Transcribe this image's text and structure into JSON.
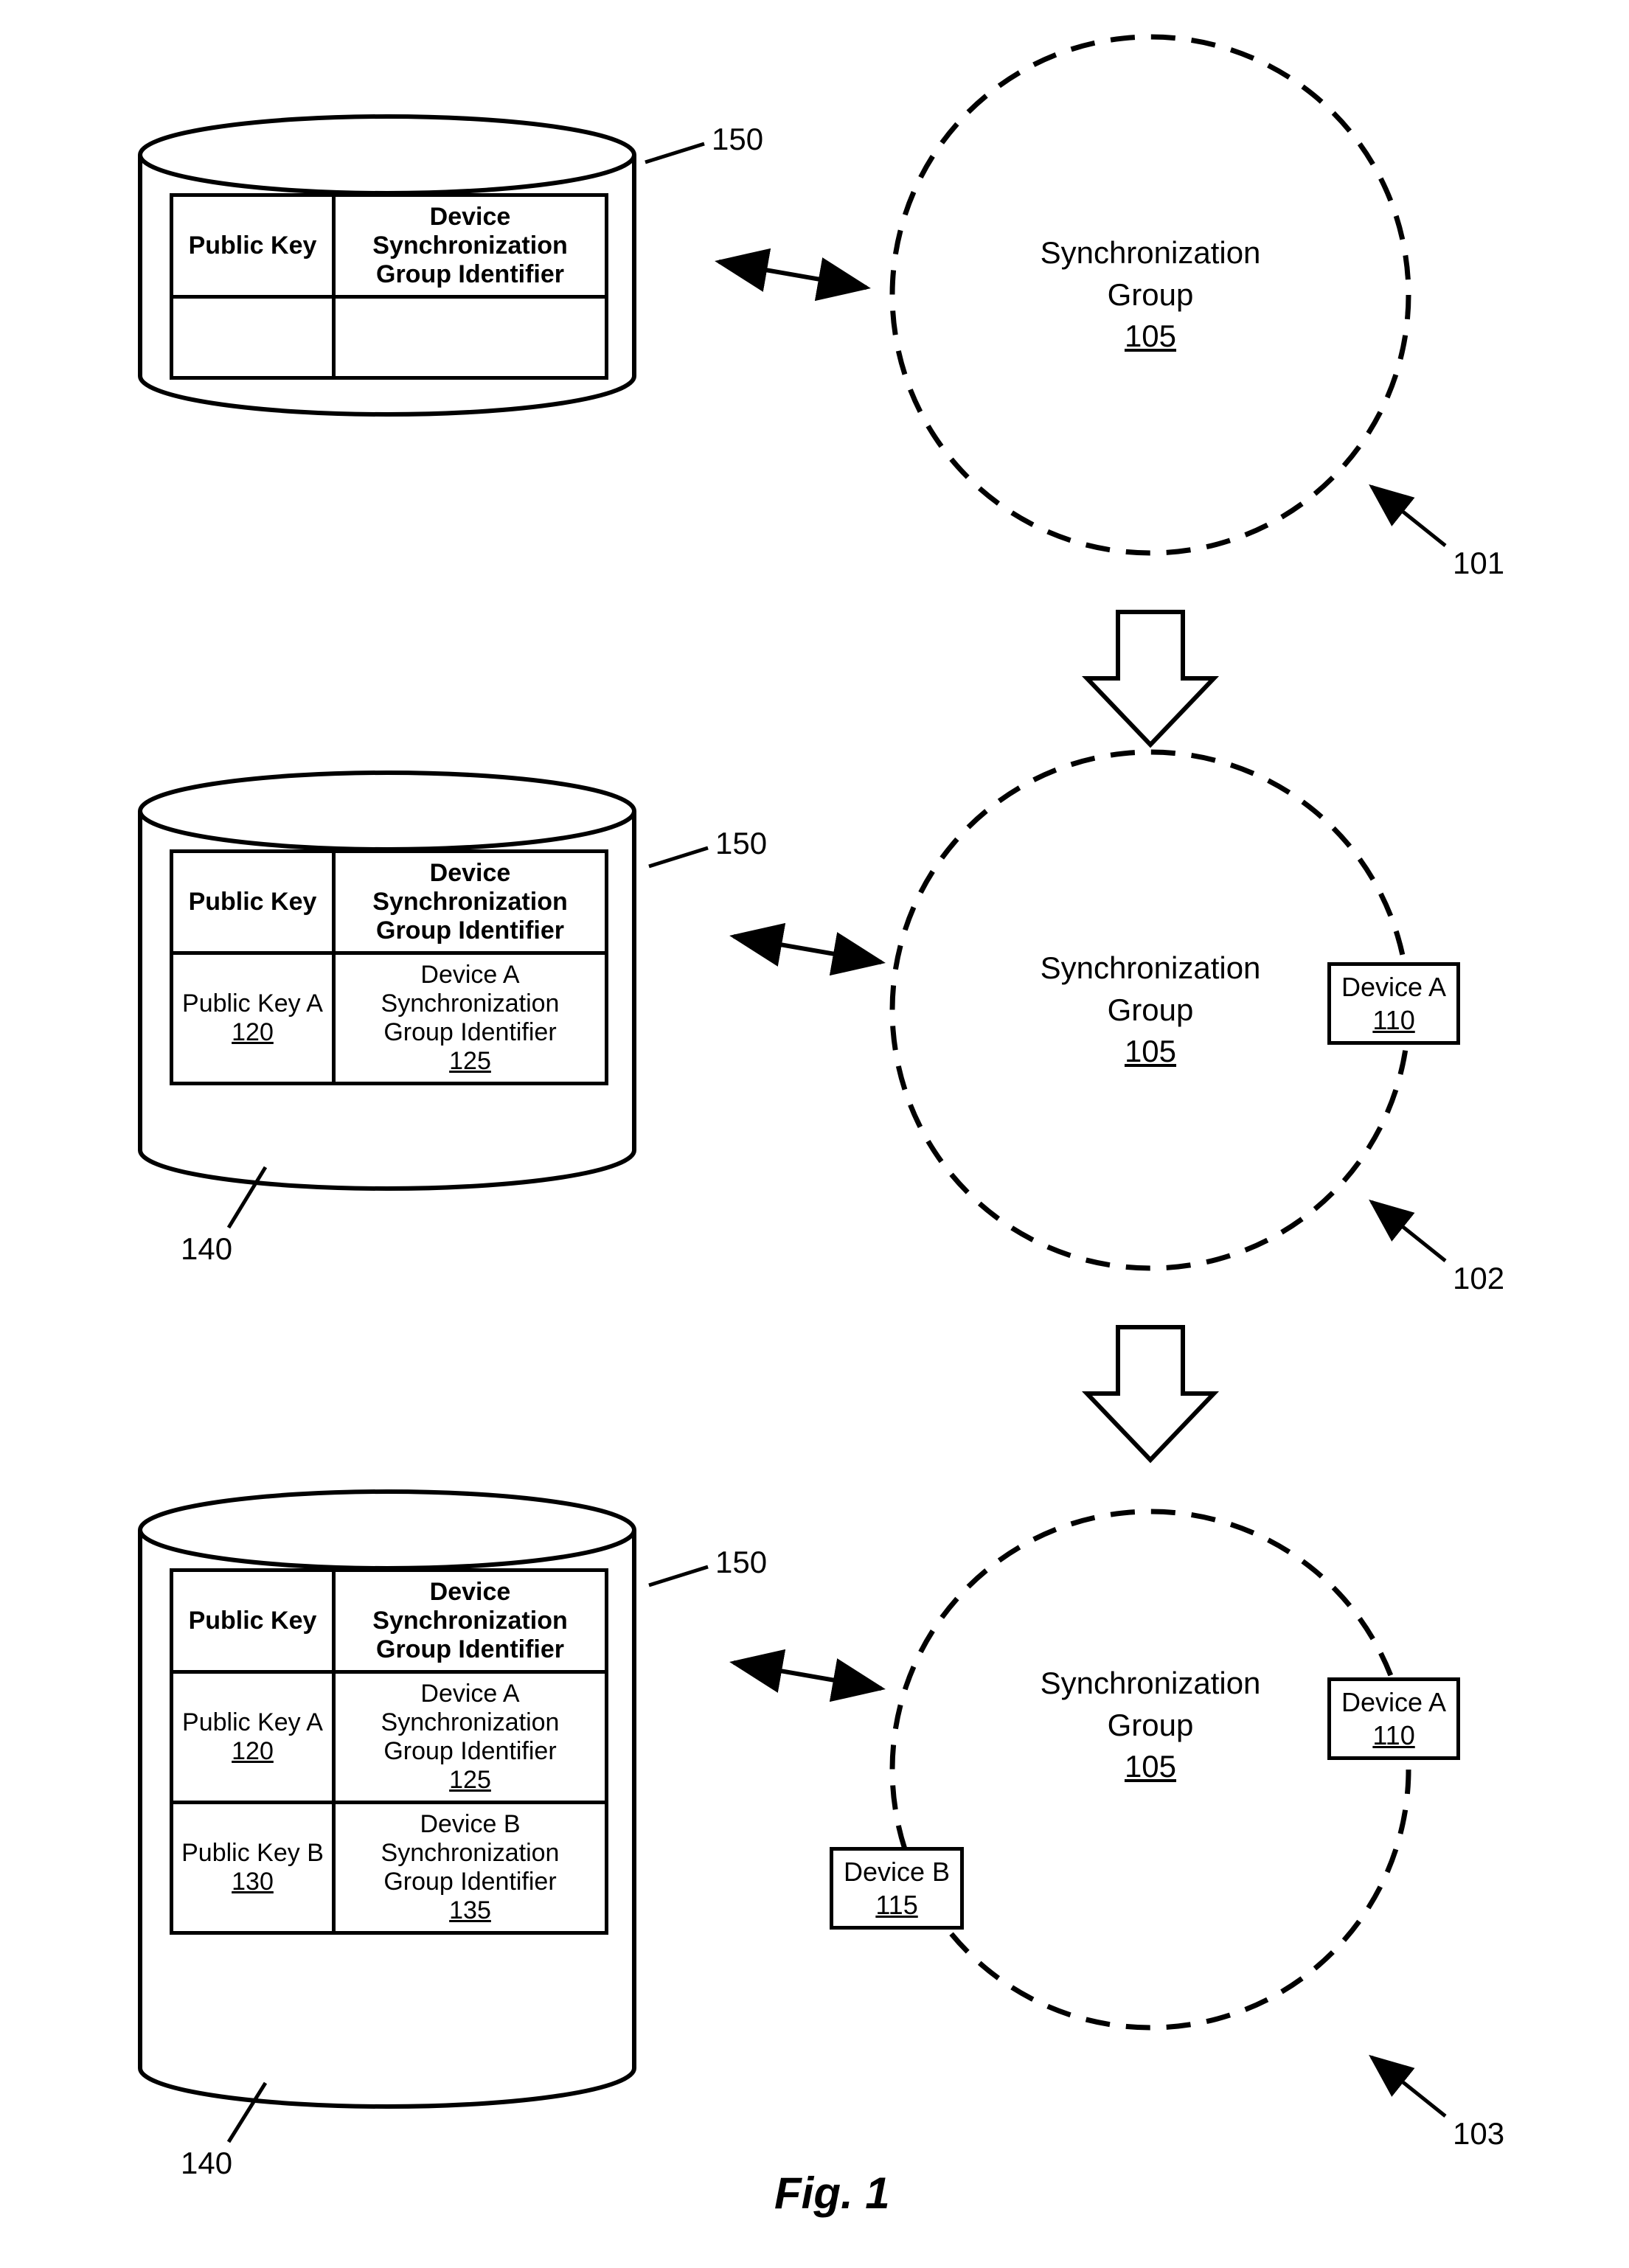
{
  "figure_caption": "Fig. 1",
  "sync_group_title": "Synchronization",
  "sync_group_sub": "Group",
  "sync_group_ref": "105",
  "device_a_name": "Device A",
  "device_a_ref": "110",
  "device_b_name": "Device B",
  "device_b_ref": "115",
  "stage_ref_1": "101",
  "stage_ref_2": "102",
  "stage_ref_3": "103",
  "table_header_left": "Public Key",
  "table_header_right": "Device Synchronization Group Identifier",
  "row_a_left": "Public Key A",
  "row_a_left_ref": "120",
  "row_a_right": "Device A Synchronization Group Identifier",
  "row_a_right_ref": "125",
  "row_b_left": "Public Key B",
  "row_b_left_ref": "130",
  "row_b_right": "Device B Synchronization Group Identifier",
  "row_b_right_ref": "135",
  "table_ref": "140",
  "cylinder_ref": "150"
}
